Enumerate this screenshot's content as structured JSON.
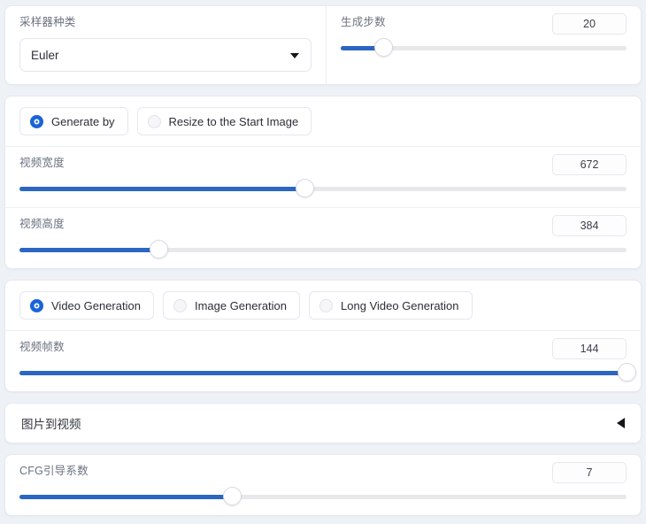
{
  "sampler_panel": {
    "sampler": {
      "label": "采样器种类",
      "value": "Euler",
      "caret_icon": "chevron-down-icon"
    },
    "steps": {
      "label": "生成步数",
      "value": "20",
      "fill_percent": 15
    }
  },
  "size_panel": {
    "mode_options": [
      {
        "label": "Generate by",
        "selected": true
      },
      {
        "label": "Resize to the Start Image",
        "selected": false
      }
    ],
    "width": {
      "label": "视频宽度",
      "value": "672",
      "fill_percent": 47
    },
    "height": {
      "label": "视频高度",
      "value": "384",
      "fill_percent": 23
    }
  },
  "generation_panel": {
    "mode_options": [
      {
        "label": "Video Generation",
        "selected": true
      },
      {
        "label": "Image Generation",
        "selected": false
      },
      {
        "label": "Long Video Generation",
        "selected": false
      }
    ],
    "frames": {
      "label": "视频帧数",
      "value": "144",
      "fill_percent": 100
    }
  },
  "image_to_video_accordion": {
    "title": "图片到视频",
    "caret_icon": "caret-left-icon",
    "collapsed": true
  },
  "cfg_panel": {
    "cfg": {
      "label": "CFG引导系数",
      "value": "7",
      "fill_percent": 35
    }
  },
  "colors": {
    "accent_blue": "#2b66c2",
    "radio_blue": "#1a64d8",
    "page_background": "#eef2f7",
    "panel_background": "#ffffff",
    "track_gray": "#e7e8ea",
    "label_gray": "#6b7280"
  }
}
